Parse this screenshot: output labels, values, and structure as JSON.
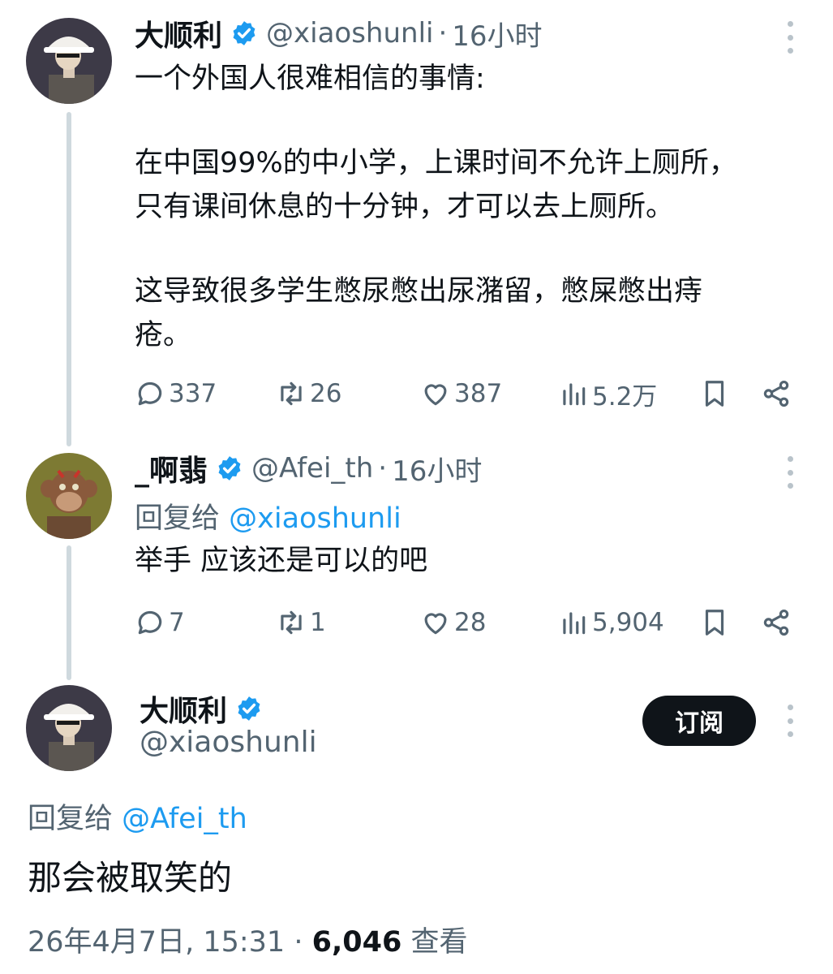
{
  "tweet1": {
    "author": "大顺利",
    "handle": "@xiaoshunli",
    "separator": "·",
    "time": "16小时",
    "text_line1": "一个外国人很难相信的事情:",
    "text_para2": "在中国99%的中小学，上课时间不允许上厕所，\n只有课间休息的十分钟，才可以去上厕所。",
    "text_para3": "这导致很多学生憋尿憋出尿潴留，憋屎憋出痔\n疮。",
    "replies": "337",
    "reposts": "26",
    "likes": "387",
    "views": "5.2万"
  },
  "tweet2": {
    "author": "_啊翡",
    "handle": "@Afei_th",
    "separator": "·",
    "time": "16小时",
    "reply_prefix": "回复给",
    "reply_mention": "@xiaoshunli",
    "text": "举手 应该还是可以的吧",
    "replies": "7",
    "reposts": "1",
    "likes": "28",
    "views": "5,904"
  },
  "tweet3": {
    "author": "大顺利",
    "handle": "@xiaoshunli",
    "subscribe_label": "订阅",
    "reply_prefix": "回复给",
    "reply_mention": "@Afei_th",
    "text": "那会被取笑的",
    "timestamp": "26年4月7日, 15:31",
    "separator": "·",
    "view_count": "6,046",
    "view_label": "查看"
  },
  "icons": {
    "verified": "verified-badge-icon",
    "more": "more-dots-icon",
    "reply": "reply-bubble-icon",
    "repost": "repost-icon",
    "like": "heart-icon",
    "views": "bar-chart-icon",
    "bookmark": "bookmark-icon",
    "share": "share-icon"
  },
  "colors": {
    "link": "#1d9bf0",
    "verified": "#1d9bf0",
    "secondary_text": "#536471",
    "primary_text": "#0f1419",
    "thread_line": "#cfd9de",
    "subscribe_bg": "#0f1419"
  }
}
